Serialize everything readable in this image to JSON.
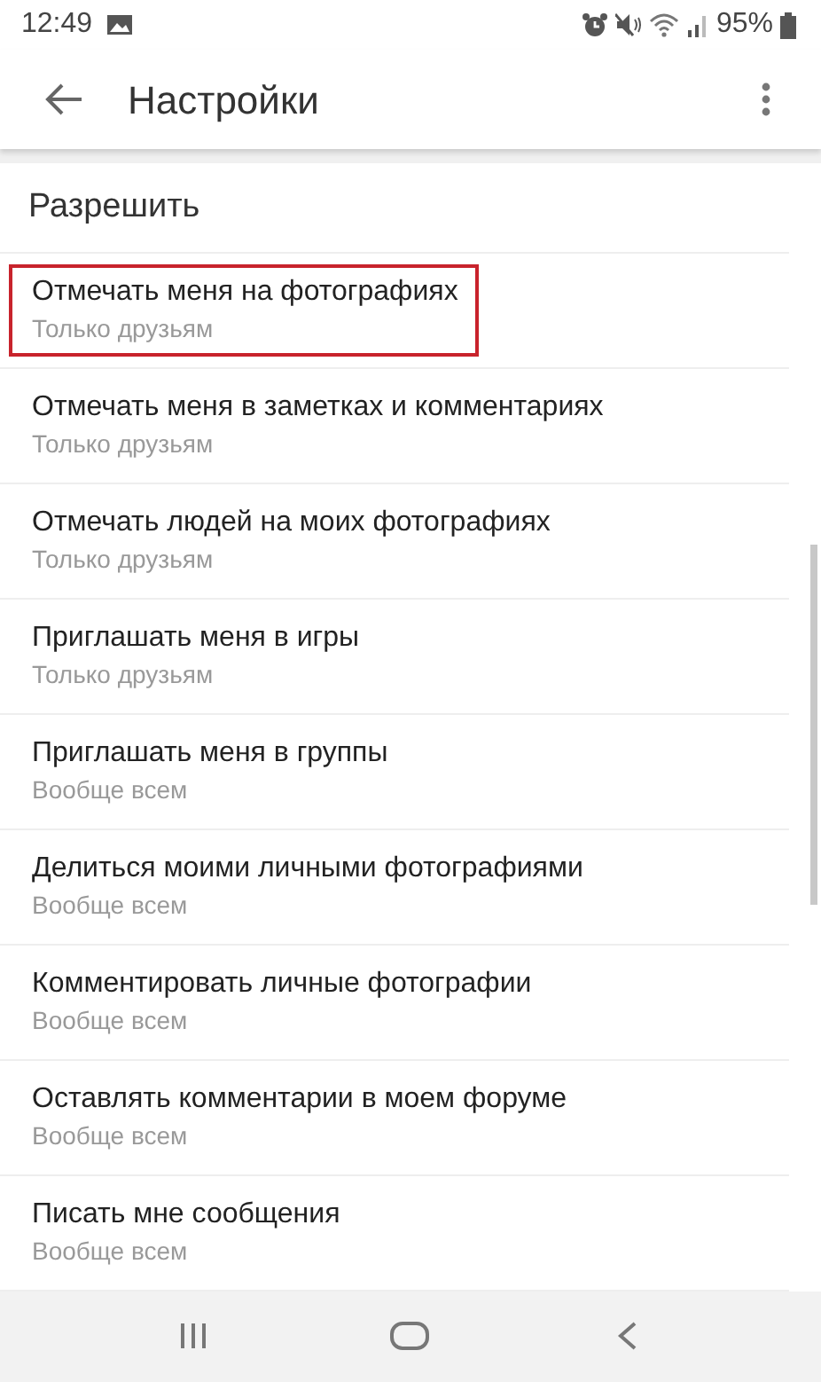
{
  "status_bar": {
    "time": "12:49",
    "battery": "95%"
  },
  "app_bar": {
    "title": "Настройки"
  },
  "section": {
    "title": "Разрешить"
  },
  "items": [
    {
      "title": "Отмечать меня на фотографиях",
      "value": "Только друзьям",
      "highlighted": true
    },
    {
      "title": "Отмечать меня в заметках и комментариях",
      "value": "Только друзьям",
      "highlighted": false
    },
    {
      "title": "Отмечать людей на моих фотографиях",
      "value": "Только друзьям",
      "highlighted": false
    },
    {
      "title": "Приглашать меня в игры",
      "value": "Только друзьям",
      "highlighted": false
    },
    {
      "title": "Приглашать меня в группы",
      "value": "Вообще всем",
      "highlighted": false
    },
    {
      "title": "Делиться моими личными фотографиями",
      "value": "Вообще всем",
      "highlighted": false
    },
    {
      "title": "Комментировать личные фотографии",
      "value": "Вообще всем",
      "highlighted": false
    },
    {
      "title": "Оставлять комментарии в моем форуме",
      "value": "Вообще всем",
      "highlighted": false
    },
    {
      "title": "Писать мне сообщения",
      "value": "Вообще всем",
      "highlighted": false
    }
  ]
}
